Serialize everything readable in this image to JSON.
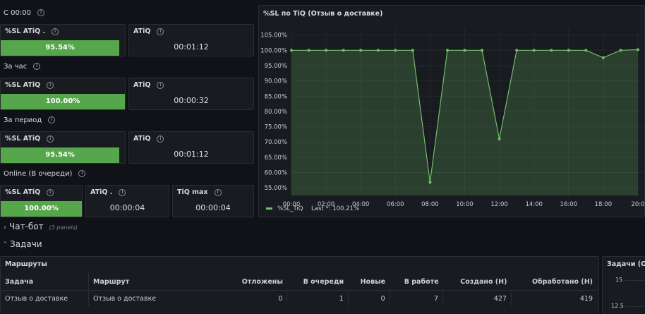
{
  "sections": {
    "since_midnight": "С 00:00",
    "last_hour": "За час",
    "period": "За период",
    "online": "Online (В очереди)"
  },
  "stats": {
    "s1": {
      "sl_title": "%SL ATiQ .",
      "sl_value": "95.54%",
      "sl_fraction": 0.9554,
      "atiq_title": "ATiQ",
      "atiq_value": "00:01:12"
    },
    "s2": {
      "sl_title": "%SL ATiQ",
      "sl_value": "100.00%",
      "sl_fraction": 1.0,
      "atiq_title": "ATiQ",
      "atiq_value": "00:00:32"
    },
    "s3": {
      "sl_title": "%SL ATiQ",
      "sl_value": "95.54%",
      "sl_fraction": 0.9554,
      "atiq_title": "ATiQ",
      "atiq_value": "00:01:12"
    },
    "s4": {
      "sl_title": "%SL ATiQ",
      "sl_value": "100.00%",
      "sl_fraction": 1.0,
      "atiq_title": "ATiQ .",
      "atiq_value": "00:00:04",
      "tiq_title": "TiQ max",
      "tiq_value": "00:00:04"
    }
  },
  "chart_panel": {
    "title": "%SL по TiQ (Отзыв о доставке)"
  },
  "chart_data": {
    "type": "area",
    "title": "%SL по TiQ (Отзыв о доставке)",
    "xlabel": "",
    "ylabel": "",
    "x": [
      "00:00",
      "01:00",
      "02:00",
      "03:00",
      "04:00",
      "05:00",
      "06:00",
      "07:00",
      "08:00",
      "09:00",
      "10:00",
      "11:00",
      "12:00",
      "13:00",
      "14:00",
      "15:00",
      "16:00",
      "17:00",
      "18:00",
      "19:00",
      "20:00"
    ],
    "x_ticks": [
      "00:00",
      "02:00",
      "04:00",
      "06:00",
      "08:00",
      "10:00",
      "12:00",
      "14:00",
      "16:00",
      "18:00",
      "20:0"
    ],
    "y_ticks": [
      "55.00%",
      "60.00%",
      "65.00%",
      "70.00%",
      "75.00%",
      "80.00%",
      "85.00%",
      "90.00%",
      "95.00%",
      "100.00%",
      "105.00%"
    ],
    "ylim": [
      52.5,
      107
    ],
    "series": [
      {
        "name": "%SL_TiQ",
        "color": "#73bf69",
        "values": [
          100,
          100,
          100,
          100,
          100,
          100,
          100,
          100,
          56.8,
          100,
          100,
          100,
          71.0,
          100,
          100,
          100,
          100,
          100,
          97.6,
          100,
          100.21
        ]
      }
    ],
    "legend": {
      "label": "%SL_TiQ",
      "stat": "Last *: 100.21%",
      "position": "bottom-left"
    },
    "grid": true
  },
  "rows": {
    "chatbot": {
      "label": "Чат-бот",
      "meta": "(3 panels)"
    },
    "tasks": {
      "label": "Задачи"
    }
  },
  "routes_panel": {
    "title": "Маршруты",
    "columns": [
      "Задача",
      "Маршрут",
      "Отложены",
      "В очереди",
      "Новые",
      "В работе",
      "Создано (Н)",
      "Обработано (Н)"
    ],
    "rows": [
      [
        "Отзыв о доставке",
        "Отзыв о доставке",
        "0",
        "1",
        "0",
        "7",
        "427",
        "419"
      ]
    ]
  },
  "tasks_panel": {
    "title": "Задачи (От",
    "y_ticks": [
      "15",
      "12.5"
    ]
  },
  "colors": {
    "background": "#111217",
    "panel": "#181b1f",
    "gauge": "#56a64b",
    "line": "#73bf69"
  }
}
